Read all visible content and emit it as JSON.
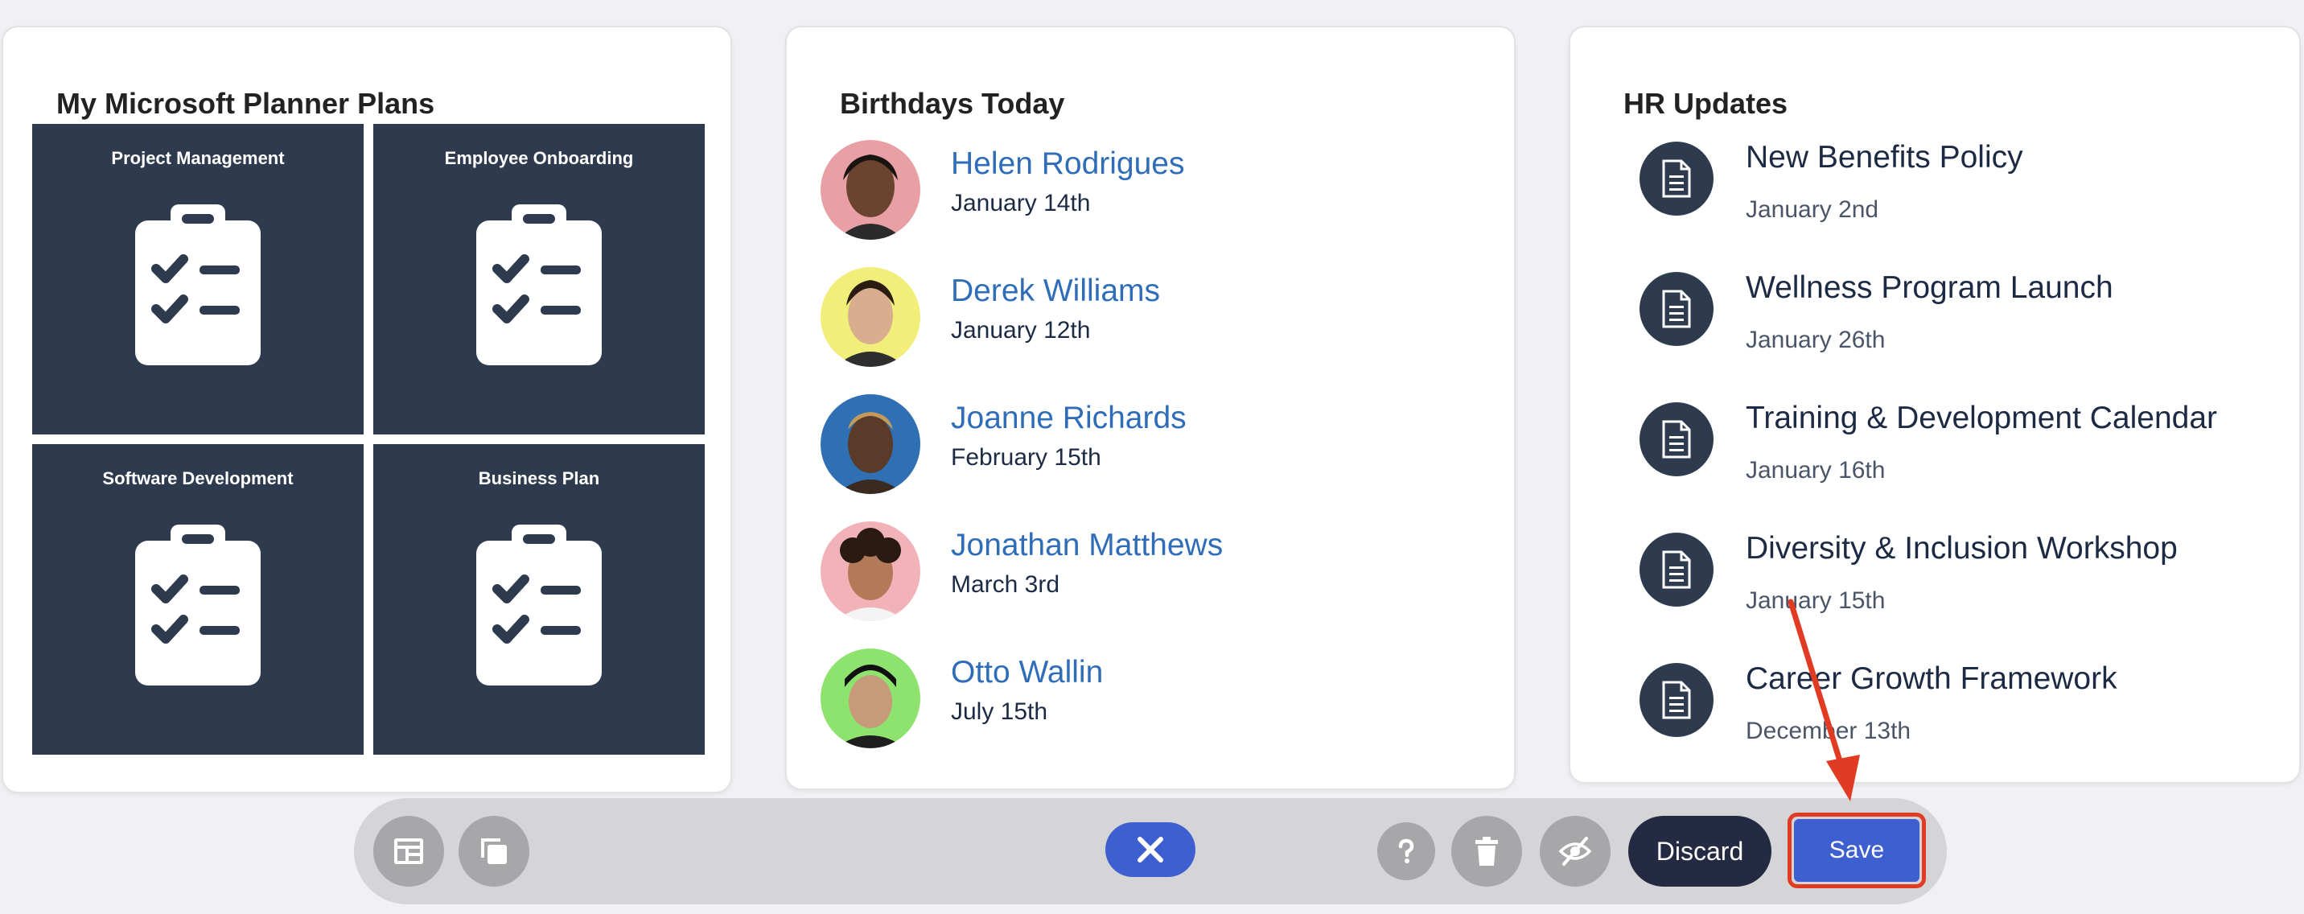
{
  "planner": {
    "title": "My Microsoft Planner Plans",
    "plans": [
      {
        "label": "Project Management",
        "icon": "clipboard-checklist-icon"
      },
      {
        "label": "Employee Onboarding",
        "icon": "clipboard-checklist-icon"
      },
      {
        "label": "Software Development",
        "icon": "clipboard-checklist-icon"
      },
      {
        "label": "Business Plan",
        "icon": "clipboard-checklist-icon"
      }
    ]
  },
  "birthdays": {
    "title": "Birthdays Today",
    "people": [
      {
        "name": "Helen Rodrigues",
        "date": "January 14th",
        "avatar_bg": "#e8a0a4"
      },
      {
        "name": "Derek Williams",
        "date": "January 12th",
        "avatar_bg": "#f1ef7a"
      },
      {
        "name": "Joanne Richards",
        "date": "February 15th",
        "avatar_bg": "#2f6fb3"
      },
      {
        "name": "Jonathan Matthews",
        "date": "March 3rd",
        "avatar_bg": "#f2b3b8"
      },
      {
        "name": "Otto Wallin",
        "date": "July 15th",
        "avatar_bg": "#8ee36e"
      }
    ]
  },
  "hr_updates": {
    "title": "HR Updates",
    "items": [
      {
        "title": "New Benefits Policy",
        "date": "January 2nd",
        "icon": "document-icon"
      },
      {
        "title": "Wellness Program Launch",
        "date": "January 26th",
        "icon": "document-icon"
      },
      {
        "title": "Training & Development Calendar",
        "date": "January 16th",
        "icon": "document-icon"
      },
      {
        "title": "Diversity & Inclusion Workshop",
        "date": "January 15th",
        "icon": "document-icon"
      },
      {
        "title": "Career Growth Framework",
        "date": "December 13th",
        "icon": "document-icon"
      }
    ]
  },
  "toolbar": {
    "layout_icon": "layout-icon",
    "copy_icon": "copy-icon",
    "close_icon": "close-icon",
    "help_icon": "help-icon",
    "delete_icon": "trash-icon",
    "hide_icon": "eye-slash-icon",
    "discard_label": "Discard",
    "save_label": "Save"
  },
  "colors": {
    "tile": "#2e3b4e",
    "link": "#2f6db8",
    "primary": "#3d5fd0",
    "discard": "#242a42",
    "annotation": "#e23b24"
  }
}
